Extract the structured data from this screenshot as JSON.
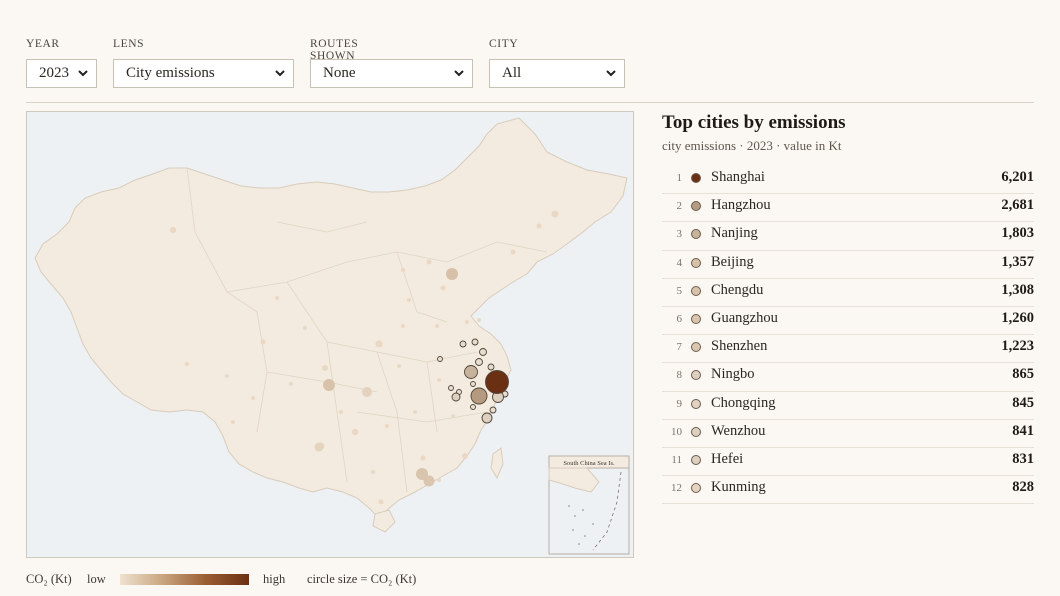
{
  "controls": {
    "year": {
      "label": "YEAR",
      "value": "2023"
    },
    "lens": {
      "label": "LENS",
      "value": "City emissions"
    },
    "routes": {
      "label": "ROUTES SHOWN",
      "value": "None"
    },
    "city": {
      "label": "CITY",
      "value": "All"
    }
  },
  "map": {
    "inset_label": "South China Sea Is.",
    "colors": {
      "land": "#f3ebdf",
      "border": "#d8ccbb",
      "water": "#eef1f4",
      "low": "#efe2d0",
      "high": "#6b3013"
    }
  },
  "panel": {
    "title": "Top cities by emissions",
    "subtitle": "city emissions · 2023 · value in Kt",
    "rows": [
      {
        "rank": "1",
        "name": "Shanghai",
        "value": "6,201",
        "color": "#6b3013"
      },
      {
        "rank": "2",
        "name": "Hangzhou",
        "value": "2,681",
        "color": "#b39a80"
      },
      {
        "rank": "3",
        "name": "Nanjing",
        "value": "1,803",
        "color": "#c7b29b"
      },
      {
        "rank": "4",
        "name": "Beijing",
        "value": "1,357",
        "color": "#d6c1a8"
      },
      {
        "rank": "5",
        "name": "Chengdu",
        "value": "1,308",
        "color": "#d8c3aa"
      },
      {
        "rank": "6",
        "name": "Guangzhou",
        "value": "1,260",
        "color": "#d9c5ad"
      },
      {
        "rank": "7",
        "name": "Shenzhen",
        "value": "1,223",
        "color": "#dac6ae"
      },
      {
        "rank": "8",
        "name": "Ningbo",
        "value": "865",
        "color": "#ddd0c0"
      },
      {
        "rank": "9",
        "name": "Chongqing",
        "value": "845",
        "color": "#e2d2bf"
      },
      {
        "rank": "10",
        "name": "Wenzhou",
        "value": "841",
        "color": "#ddd0c0"
      },
      {
        "rank": "11",
        "name": "Hefei",
        "value": "831",
        "color": "#ddd0c0"
      },
      {
        "rank": "12",
        "name": "Kunming",
        "value": "828",
        "color": "#e4d3bf"
      }
    ]
  },
  "legend": {
    "metric": "CO₂ (Kt)",
    "low": "low",
    "high": "high",
    "size_note": "circle size = CO₂ (Kt)"
  }
}
